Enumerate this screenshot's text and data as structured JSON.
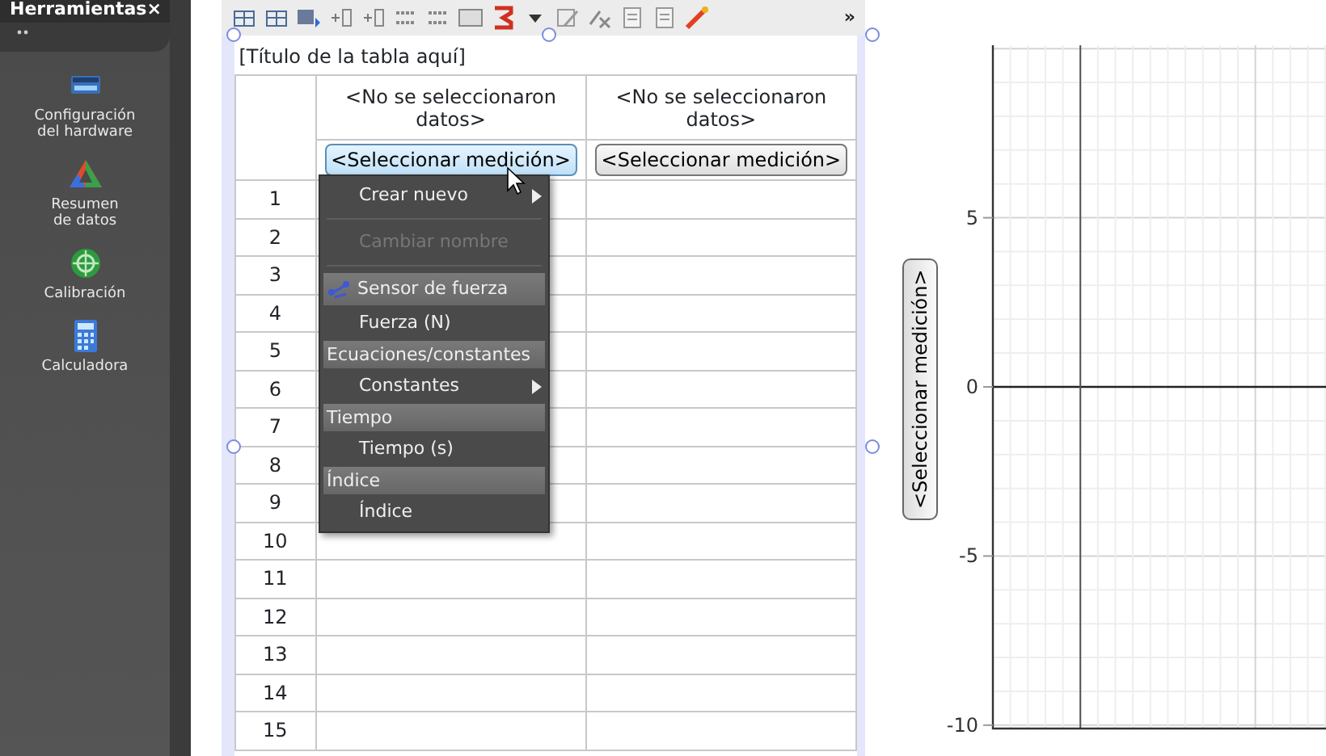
{
  "sidebar": {
    "title": "Herramientas",
    "close": "×",
    "items": [
      {
        "label": "Configuración\ndel hardware"
      },
      {
        "label": "Resumen\nde datos"
      },
      {
        "label": "Calibración"
      },
      {
        "label": "Calculadora"
      }
    ]
  },
  "toolbar": {
    "overflow": "»"
  },
  "table": {
    "title": "[Título de la tabla aquí]",
    "columns": [
      {
        "header": "<No se seleccionaron datos>",
        "button": "<Seleccionar medición>",
        "hovered": true
      },
      {
        "header": "<No se seleccionaron datos>",
        "button": "<Seleccionar medición>",
        "hovered": false
      }
    ],
    "row_numbers": [
      "1",
      "2",
      "3",
      "4",
      "5",
      "6",
      "7",
      "8",
      "9",
      "10",
      "11",
      "12",
      "13",
      "14",
      "15"
    ]
  },
  "menu": {
    "items": [
      {
        "kind": "item",
        "label": "Crear nuevo",
        "submenu": true,
        "disabled": false
      },
      {
        "kind": "separator"
      },
      {
        "kind": "item",
        "label": "Cambiar nombre",
        "submenu": false,
        "disabled": true
      },
      {
        "kind": "separator"
      },
      {
        "kind": "sensor",
        "label": "Sensor de fuerza"
      },
      {
        "kind": "item",
        "label": "Fuerza (N)",
        "submenu": false,
        "disabled": false
      },
      {
        "kind": "header",
        "label": "Ecuaciones/constantes"
      },
      {
        "kind": "item",
        "label": "Constantes",
        "submenu": true,
        "disabled": false
      },
      {
        "kind": "header",
        "label": "Tiempo"
      },
      {
        "kind": "item",
        "label": "Tiempo (s)",
        "submenu": false,
        "disabled": false
      },
      {
        "kind": "header",
        "label": "Índice"
      },
      {
        "kind": "item",
        "label": "Índice",
        "submenu": false,
        "disabled": false
      }
    ]
  },
  "graph": {
    "axis_button": "<Seleccionar medición>",
    "y_axis_labels": [
      "5",
      "0",
      "-5",
      "-10"
    ]
  }
}
